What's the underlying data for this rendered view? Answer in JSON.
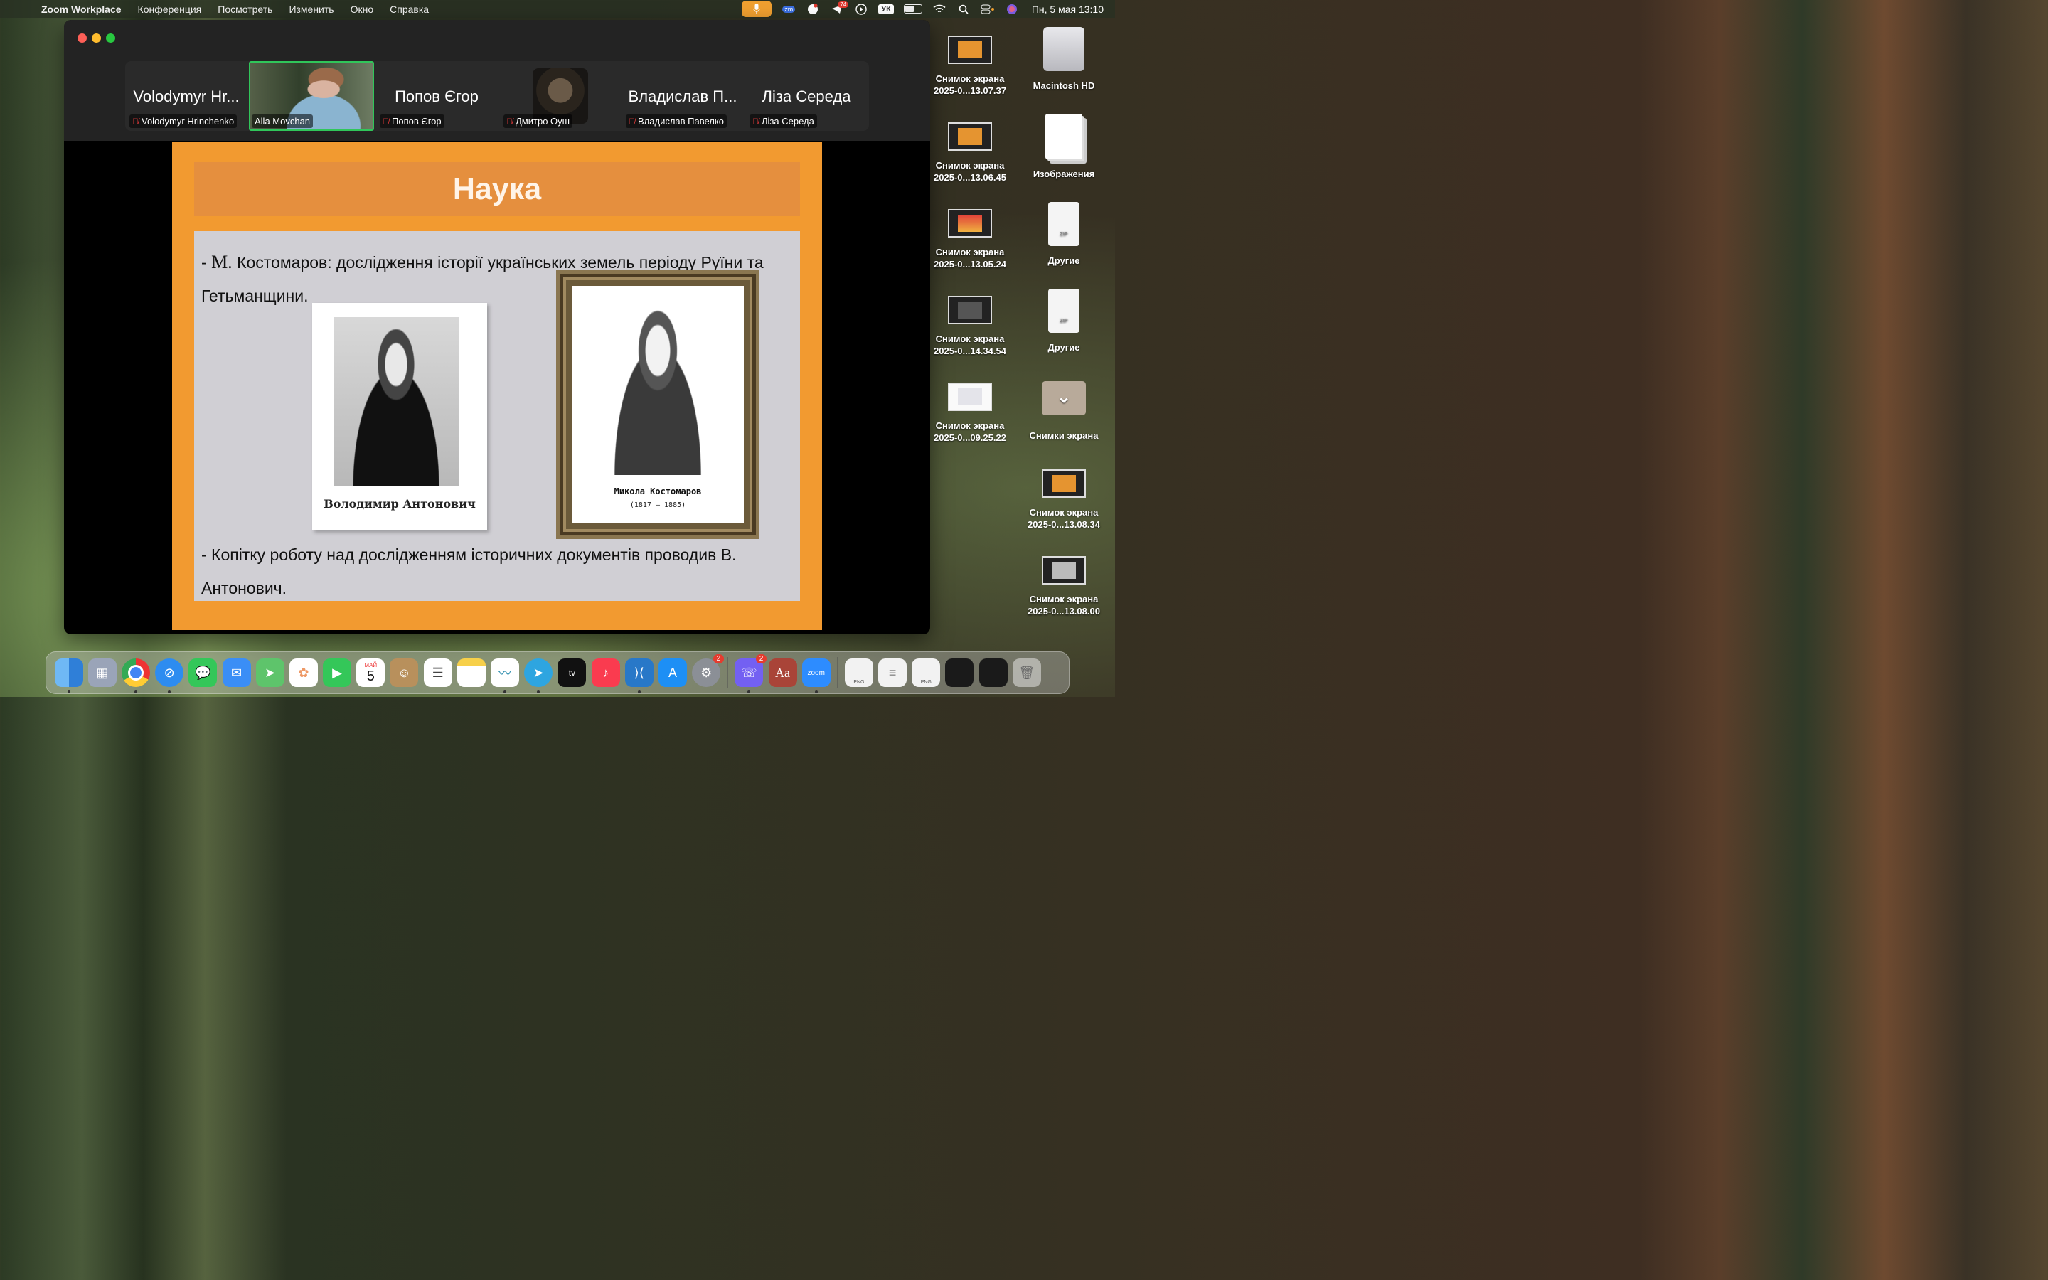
{
  "menubar": {
    "app_name": "Zoom Workplace",
    "menus": [
      "Конференция",
      "Посмотреть",
      "Изменить",
      "Окно",
      "Справка"
    ],
    "status": {
      "telegram_badge": "74",
      "input_source": "УК",
      "datetime": "Пн, 5 мая  13:10"
    }
  },
  "zoom": {
    "participants": [
      {
        "big_label": "Volodymyr Hr...",
        "name": "Volodymyr Hrinchenko",
        "video": false
      },
      {
        "big_label": "",
        "name": "Alla Movchan",
        "video": true,
        "active": true
      },
      {
        "big_label": "Попов Єгор",
        "name": "Попов Єгор",
        "video": false
      },
      {
        "big_label": "",
        "name": "Дмитро Оуш",
        "video": false,
        "avatar": true
      },
      {
        "big_label": "Владислав П...",
        "name": "Владислав Павелко",
        "video": false
      },
      {
        "big_label": "Ліза Середа",
        "name": "Ліза Середа",
        "video": false
      }
    ]
  },
  "slide": {
    "title": "Наука",
    "para1_dash": "- ",
    "para1_m": "М.",
    "para1_rest": " Костомаров: дослідження історії українських земель періоду Руїни та Гетьманщини.",
    "portrait1_caption": "Володимир Антонович",
    "portrait2_caption": "Микола Костомаров",
    "portrait2_years": "(1817 – 1885)",
    "para2": "- Копітку роботу над дослідженням історичних документів проводив В. Антонович."
  },
  "desktop": {
    "items": [
      {
        "line1": "Снимок экрана",
        "line2": "2025-0...13.07.37"
      },
      {
        "line1": "Macintosh HD",
        "line2": ""
      },
      {
        "line1": "Снимок экрана",
        "line2": "2025-0...13.06.45"
      },
      {
        "line1": "Изображения",
        "line2": ""
      },
      {
        "line1": "Снимок экрана",
        "line2": "2025-0...13.05.24"
      },
      {
        "line1": "Другие",
        "line2": ""
      },
      {
        "line1": "Снимок экрана",
        "line2": "2025-0...14.34.54"
      },
      {
        "line1": "Другие",
        "line2": ""
      },
      {
        "line1": "Снимок экрана",
        "line2": "2025-0...09.25.22"
      },
      {
        "line1": "Снимки экрана",
        "line2": ""
      },
      {
        "line1": "Снимок экрана",
        "line2": "2025-0...13.08.34"
      },
      {
        "line1": "Снимок экрана",
        "line2": "2025-0...13.08.00"
      }
    ],
    "zip_label": "ZIP"
  },
  "dock": {
    "calendar_month": "МАЙ",
    "calendar_day": "5",
    "settings_badge": "2",
    "viber_badge": "2",
    "dictionary_label": "Aa",
    "zoom_label": "zoom",
    "png_label": "PNG"
  }
}
